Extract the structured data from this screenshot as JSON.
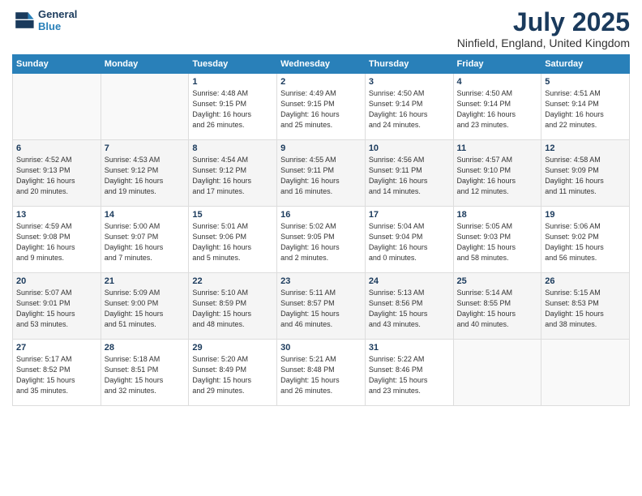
{
  "header": {
    "logo_line1": "General",
    "logo_line2": "Blue",
    "title": "July 2025",
    "subtitle": "Ninfield, England, United Kingdom"
  },
  "days_of_week": [
    "Sunday",
    "Monday",
    "Tuesday",
    "Wednesday",
    "Thursday",
    "Friday",
    "Saturday"
  ],
  "weeks": [
    [
      {
        "day": "",
        "detail": ""
      },
      {
        "day": "",
        "detail": ""
      },
      {
        "day": "1",
        "detail": "Sunrise: 4:48 AM\nSunset: 9:15 PM\nDaylight: 16 hours\nand 26 minutes."
      },
      {
        "day": "2",
        "detail": "Sunrise: 4:49 AM\nSunset: 9:15 PM\nDaylight: 16 hours\nand 25 minutes."
      },
      {
        "day": "3",
        "detail": "Sunrise: 4:50 AM\nSunset: 9:14 PM\nDaylight: 16 hours\nand 24 minutes."
      },
      {
        "day": "4",
        "detail": "Sunrise: 4:50 AM\nSunset: 9:14 PM\nDaylight: 16 hours\nand 23 minutes."
      },
      {
        "day": "5",
        "detail": "Sunrise: 4:51 AM\nSunset: 9:14 PM\nDaylight: 16 hours\nand 22 minutes."
      }
    ],
    [
      {
        "day": "6",
        "detail": "Sunrise: 4:52 AM\nSunset: 9:13 PM\nDaylight: 16 hours\nand 20 minutes."
      },
      {
        "day": "7",
        "detail": "Sunrise: 4:53 AM\nSunset: 9:12 PM\nDaylight: 16 hours\nand 19 minutes."
      },
      {
        "day": "8",
        "detail": "Sunrise: 4:54 AM\nSunset: 9:12 PM\nDaylight: 16 hours\nand 17 minutes."
      },
      {
        "day": "9",
        "detail": "Sunrise: 4:55 AM\nSunset: 9:11 PM\nDaylight: 16 hours\nand 16 minutes."
      },
      {
        "day": "10",
        "detail": "Sunrise: 4:56 AM\nSunset: 9:11 PM\nDaylight: 16 hours\nand 14 minutes."
      },
      {
        "day": "11",
        "detail": "Sunrise: 4:57 AM\nSunset: 9:10 PM\nDaylight: 16 hours\nand 12 minutes."
      },
      {
        "day": "12",
        "detail": "Sunrise: 4:58 AM\nSunset: 9:09 PM\nDaylight: 16 hours\nand 11 minutes."
      }
    ],
    [
      {
        "day": "13",
        "detail": "Sunrise: 4:59 AM\nSunset: 9:08 PM\nDaylight: 16 hours\nand 9 minutes."
      },
      {
        "day": "14",
        "detail": "Sunrise: 5:00 AM\nSunset: 9:07 PM\nDaylight: 16 hours\nand 7 minutes."
      },
      {
        "day": "15",
        "detail": "Sunrise: 5:01 AM\nSunset: 9:06 PM\nDaylight: 16 hours\nand 5 minutes."
      },
      {
        "day": "16",
        "detail": "Sunrise: 5:02 AM\nSunset: 9:05 PM\nDaylight: 16 hours\nand 2 minutes."
      },
      {
        "day": "17",
        "detail": "Sunrise: 5:04 AM\nSunset: 9:04 PM\nDaylight: 16 hours\nand 0 minutes."
      },
      {
        "day": "18",
        "detail": "Sunrise: 5:05 AM\nSunset: 9:03 PM\nDaylight: 15 hours\nand 58 minutes."
      },
      {
        "day": "19",
        "detail": "Sunrise: 5:06 AM\nSunset: 9:02 PM\nDaylight: 15 hours\nand 56 minutes."
      }
    ],
    [
      {
        "day": "20",
        "detail": "Sunrise: 5:07 AM\nSunset: 9:01 PM\nDaylight: 15 hours\nand 53 minutes."
      },
      {
        "day": "21",
        "detail": "Sunrise: 5:09 AM\nSunset: 9:00 PM\nDaylight: 15 hours\nand 51 minutes."
      },
      {
        "day": "22",
        "detail": "Sunrise: 5:10 AM\nSunset: 8:59 PM\nDaylight: 15 hours\nand 48 minutes."
      },
      {
        "day": "23",
        "detail": "Sunrise: 5:11 AM\nSunset: 8:57 PM\nDaylight: 15 hours\nand 46 minutes."
      },
      {
        "day": "24",
        "detail": "Sunrise: 5:13 AM\nSunset: 8:56 PM\nDaylight: 15 hours\nand 43 minutes."
      },
      {
        "day": "25",
        "detail": "Sunrise: 5:14 AM\nSunset: 8:55 PM\nDaylight: 15 hours\nand 40 minutes."
      },
      {
        "day": "26",
        "detail": "Sunrise: 5:15 AM\nSunset: 8:53 PM\nDaylight: 15 hours\nand 38 minutes."
      }
    ],
    [
      {
        "day": "27",
        "detail": "Sunrise: 5:17 AM\nSunset: 8:52 PM\nDaylight: 15 hours\nand 35 minutes."
      },
      {
        "day": "28",
        "detail": "Sunrise: 5:18 AM\nSunset: 8:51 PM\nDaylight: 15 hours\nand 32 minutes."
      },
      {
        "day": "29",
        "detail": "Sunrise: 5:20 AM\nSunset: 8:49 PM\nDaylight: 15 hours\nand 29 minutes."
      },
      {
        "day": "30",
        "detail": "Sunrise: 5:21 AM\nSunset: 8:48 PM\nDaylight: 15 hours\nand 26 minutes."
      },
      {
        "day": "31",
        "detail": "Sunrise: 5:22 AM\nSunset: 8:46 PM\nDaylight: 15 hours\nand 23 minutes."
      },
      {
        "day": "",
        "detail": ""
      },
      {
        "day": "",
        "detail": ""
      }
    ]
  ]
}
